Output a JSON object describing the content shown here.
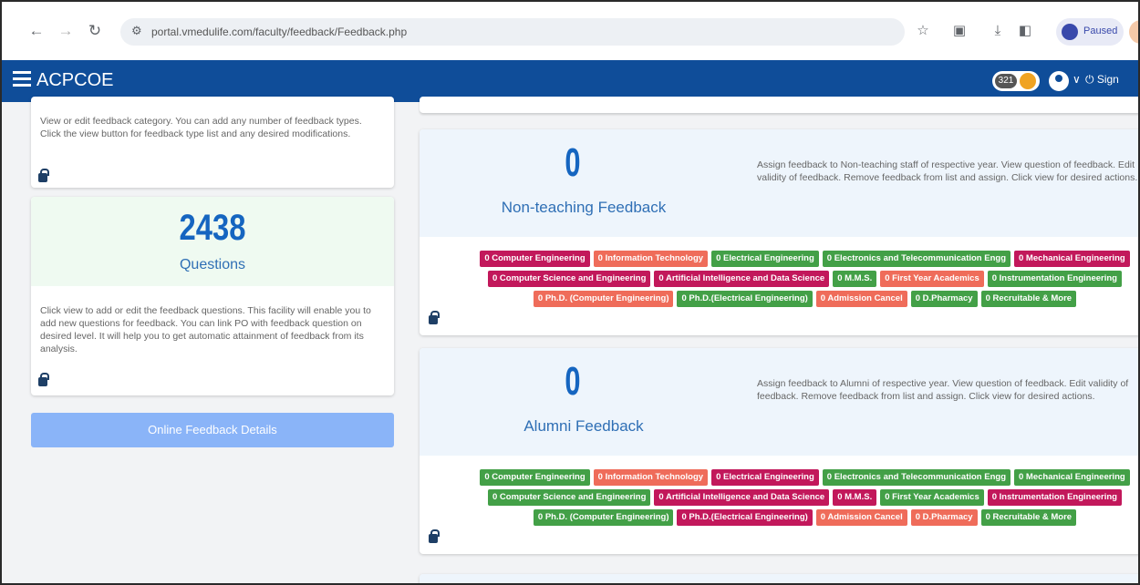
{
  "browser": {
    "url": "portal.vmedulife.com/faculty/feedback/Feedback.php",
    "profile_label": "Paused"
  },
  "app": {
    "title": "ACPCOE",
    "badge_count": "321",
    "signout": "Sign"
  },
  "left": {
    "category_desc": "View or edit feedback category. You can add any number of feedback types. Click the view button for feedback type list and any desired modifications.",
    "questions_count": "2438",
    "questions_label": "Questions",
    "questions_desc": "Click view to add or edit the feedback questions. This facility will enable you to add new questions for feedback. You can link PO with feedback question on desired level. It will help you to get automatic attainment of feedback from its analysis.",
    "details_button": "Online Feedback Details"
  },
  "cards": [
    {
      "count": "0",
      "label": "Non-teaching Feedback",
      "desc": "Assign feedback to Non-teaching staff of respective year. View question of feedback. Edit validity of feedback. Remove feedback from list and assign. Click view for desired actions.",
      "tags": [
        {
          "text": "0 Computer Engineering",
          "color": "red"
        },
        {
          "text": "0 Information Technology",
          "color": "salmon"
        },
        {
          "text": "0 Electrical Engineering",
          "color": "green"
        },
        {
          "text": "0 Electronics and Telecommunication Engg",
          "color": "green"
        },
        {
          "text": "0 Mechanical Engineering",
          "color": "red"
        },
        {
          "text": "0 Computer Science and Engineering",
          "color": "red"
        },
        {
          "text": "0 Artificial Intelligence and Data Science",
          "color": "red"
        },
        {
          "text": "0 M.M.S.",
          "color": "green"
        },
        {
          "text": "0 First Year Academics",
          "color": "salmon"
        },
        {
          "text": "0 Instrumentation Engineering",
          "color": "green"
        },
        {
          "text": "0 Ph.D. (Computer Engineering)",
          "color": "salmon"
        },
        {
          "text": "0 Ph.D.(Electrical Engineering)",
          "color": "green"
        },
        {
          "text": "0 Admission Cancel",
          "color": "salmon"
        },
        {
          "text": "0 D.Pharmacy",
          "color": "green"
        },
        {
          "text": "0 Recruitable & More",
          "color": "green"
        }
      ]
    },
    {
      "count": "0",
      "label": "Alumni Feedback",
      "desc": "Assign feedback to Alumni of respective year. View question of feedback. Edit validity of feedback. Remove feedback from list and assign. Click view for desired actions.",
      "tags": [
        {
          "text": "0 Computer Engineering",
          "color": "green"
        },
        {
          "text": "0 Information Technology",
          "color": "salmon"
        },
        {
          "text": "0 Electrical Engineering",
          "color": "red"
        },
        {
          "text": "0 Electronics and Telecommunication Engg",
          "color": "green"
        },
        {
          "text": "0 Mechanical Engineering",
          "color": "green"
        },
        {
          "text": "0 Computer Science and Engineering",
          "color": "green"
        },
        {
          "text": "0 Artificial Intelligence and Data Science",
          "color": "red"
        },
        {
          "text": "0 M.M.S.",
          "color": "red"
        },
        {
          "text": "0 First Year Academics",
          "color": "green"
        },
        {
          "text": "0 Instrumentation Engineering",
          "color": "red"
        },
        {
          "text": "0 Ph.D. (Computer Engineering)",
          "color": "green"
        },
        {
          "text": "0 Ph.D.(Electrical Engineering)",
          "color": "red"
        },
        {
          "text": "0 Admission Cancel",
          "color": "salmon"
        },
        {
          "text": "0 D.Pharmacy",
          "color": "salmon"
        },
        {
          "text": "0 Recruitable & More",
          "color": "green"
        }
      ]
    }
  ],
  "colors": {
    "header": "#0f4d99",
    "accent": "#1565c0",
    "tag_red": "#c2185b",
    "tag_salmon": "#ef6c5a",
    "tag_green": "#43a047"
  }
}
